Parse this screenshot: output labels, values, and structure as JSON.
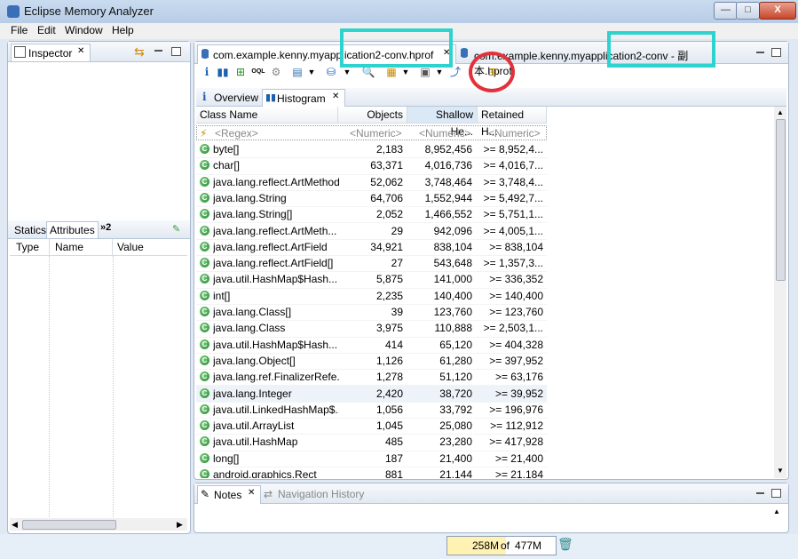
{
  "window": {
    "title": "Eclipse Memory Analyzer",
    "minimize": "—",
    "maximize": "□",
    "close": "X"
  },
  "menu": [
    "File",
    "Edit",
    "Window",
    "Help"
  ],
  "inspector": {
    "tab_label": "Inspector",
    "sub_tabs": [
      "Statics",
      "Attributes",
      "»2"
    ],
    "columns": [
      "Type",
      "Name",
      "Value"
    ]
  },
  "editor": {
    "tabs": [
      {
        "label": "com.example.kenny.myapplication2-conv.hprof"
      },
      {
        "label": "com.example.kenny.myapplication2-conv - 副本.hprof"
      }
    ],
    "sub_tabs": [
      {
        "label": "Overview"
      },
      {
        "label": "Histogram"
      }
    ],
    "toolbar_icons": [
      "info-icon",
      "histogram-icon",
      "dominator-tree-icon",
      "oql-icon",
      "thread-icon",
      "query-browser-icon",
      "heap-dump-overview-icon",
      "search-icon",
      "group-by-icon",
      "calculate-retained-icon",
      "export-icon",
      "compare-icon"
    ]
  },
  "histogram": {
    "columns": [
      "Class Name",
      "Objects",
      "Shallow He...",
      "Retained H..."
    ],
    "filter": {
      "name": "<Regex>",
      "objects": "<Numeric>",
      "shallow": "<Numeric>",
      "retained": "<Numeric>"
    },
    "rows": [
      {
        "name": "byte[]",
        "objects": "2,183",
        "shallow": "8,952,456",
        "retained": ">= 8,952,4..."
      },
      {
        "name": "char[]",
        "objects": "63,371",
        "shallow": "4,016,736",
        "retained": ">= 4,016,7..."
      },
      {
        "name": "java.lang.reflect.ArtMethod",
        "objects": "52,062",
        "shallow": "3,748,464",
        "retained": ">= 3,748,4..."
      },
      {
        "name": "java.lang.String",
        "objects": "64,706",
        "shallow": "1,552,944",
        "retained": ">= 5,492,7..."
      },
      {
        "name": "java.lang.String[]",
        "objects": "2,052",
        "shallow": "1,466,552",
        "retained": ">= 5,751,1..."
      },
      {
        "name": "java.lang.reflect.ArtMeth...",
        "objects": "29",
        "shallow": "942,096",
        "retained": ">= 4,005,1..."
      },
      {
        "name": "java.lang.reflect.ArtField",
        "objects": "34,921",
        "shallow": "838,104",
        "retained": ">= 838,104"
      },
      {
        "name": "java.lang.reflect.ArtField[]",
        "objects": "27",
        "shallow": "543,648",
        "retained": ">= 1,357,3..."
      },
      {
        "name": "java.util.HashMap$Hash...",
        "objects": "5,875",
        "shallow": "141,000",
        "retained": ">= 336,352"
      },
      {
        "name": "int[]",
        "objects": "2,235",
        "shallow": "140,400",
        "retained": ">= 140,400"
      },
      {
        "name": "java.lang.Class[]",
        "objects": "39",
        "shallow": "123,760",
        "retained": ">= 123,760"
      },
      {
        "name": "java.lang.Class",
        "objects": "3,975",
        "shallow": "110,888",
        "retained": ">= 2,503,1..."
      },
      {
        "name": "java.util.HashMap$Hash...",
        "objects": "414",
        "shallow": "65,120",
        "retained": ">= 404,328"
      },
      {
        "name": "java.lang.Object[]",
        "objects": "1,126",
        "shallow": "61,280",
        "retained": ">= 397,952"
      },
      {
        "name": "java.lang.ref.FinalizerRefe...",
        "objects": "1,278",
        "shallow": "51,120",
        "retained": ">= 63,176"
      },
      {
        "name": "java.lang.Integer",
        "objects": "2,420",
        "shallow": "38,720",
        "retained": ">= 39,952"
      },
      {
        "name": "java.util.LinkedHashMap$...",
        "objects": "1,056",
        "shallow": "33,792",
        "retained": ">= 196,976"
      },
      {
        "name": "java.util.ArrayList",
        "objects": "1,045",
        "shallow": "25,080",
        "retained": ">= 112,912"
      },
      {
        "name": "java.util.HashMap",
        "objects": "485",
        "shallow": "23,280",
        "retained": ">= 417,928"
      },
      {
        "name": "long[]",
        "objects": "187",
        "shallow": "21,400",
        "retained": ">= 21,400"
      },
      {
        "name": "android.graphics.Rect",
        "objects": "881",
        "shallow": "21,144",
        "retained": ">= 21,184"
      }
    ]
  },
  "bottom": {
    "tabs": [
      "Notes",
      "Navigation History"
    ]
  },
  "status": {
    "heap_used": "258M",
    "heap_sep": "of",
    "heap_total": "477M",
    "heap_fraction": 0.54
  },
  "colors": {
    "annotation_box": "#2ed3cf",
    "annotation_circle": "#e3313b"
  }
}
